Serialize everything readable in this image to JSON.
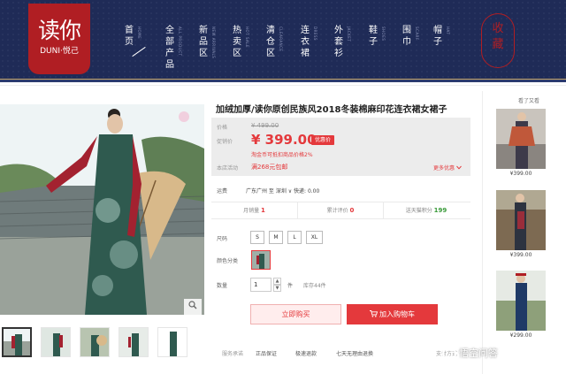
{
  "brand": {
    "logo_text": "读你",
    "logo_sub": "DUNI·悦己",
    "seal_text": "收藏"
  },
  "nav": [
    {
      "label": "首页",
      "en": "HOME"
    },
    {
      "label": "全部产品",
      "en": "ALL PRODUCT"
    },
    {
      "label": "新品区",
      "en": "NEW ARRIVALS"
    },
    {
      "label": "热卖区",
      "en": "HOT SALE"
    },
    {
      "label": "清仓区",
      "en": "CLEARANCE"
    },
    {
      "label": "连衣裙",
      "en": "DRESS"
    },
    {
      "label": "外套衫",
      "en": "JACKET"
    },
    {
      "label": "鞋子",
      "en": "SHOES"
    },
    {
      "label": "围巾",
      "en": "SCARF"
    },
    {
      "label": "帽子",
      "en": "HAT"
    }
  ],
  "product": {
    "title": "加绒加厚/读你原创民族风2018冬装棉麻印花连衣裙女裙子",
    "price_label": "价格",
    "original_price": "¥ 499.00",
    "promo_label": "促销价",
    "promo_price": "¥ 399.00",
    "promo_tag": "优惠价",
    "promo_note": "淘金币可抵扣商品价格2%",
    "activity_label": "本店活动",
    "coupon_text": "满268元包邮",
    "more_label": "更多优惠"
  },
  "shipping": {
    "label": "运费",
    "text": "广东广州 至 深圳 ∨ 快递: 0.00"
  },
  "stats": [
    {
      "label": "月销量",
      "value": "1",
      "green": false
    },
    {
      "label": "累计评价",
      "value": "0",
      "green": false
    },
    {
      "label": "送天猫积分",
      "value": "199",
      "green": true
    }
  ],
  "options": {
    "size_label": "尺码",
    "sizes": [
      "S",
      "M",
      "L",
      "XL"
    ],
    "color_label": "颜色分类",
    "quantity_label": "数量",
    "quantity_value": "1",
    "quantity_unit": "件",
    "stock_text": "库存44件"
  },
  "actions": {
    "buy_now": "立即购买",
    "add_to_cart": "加入购物车"
  },
  "service": {
    "label": "服务承诺",
    "items": [
      "正品保证",
      "极速退款",
      "七天无理由退换"
    ],
    "pay_label": "支付方式"
  },
  "sidebar": {
    "title": "看了又看",
    "prices": [
      "¥399.00",
      "¥399.00",
      "¥299.00"
    ]
  },
  "watermark": "悟空问答",
  "icons": {
    "zoom": "magnifier-icon",
    "chevron": "chevron-down-icon",
    "step_up": "arrow-up-icon",
    "step_down": "arrow-down-icon"
  },
  "colors": {
    "navy": "#1f2b57",
    "brand_red": "#b01e23",
    "price_red": "#e4393c",
    "green": "#3a9a3a"
  }
}
